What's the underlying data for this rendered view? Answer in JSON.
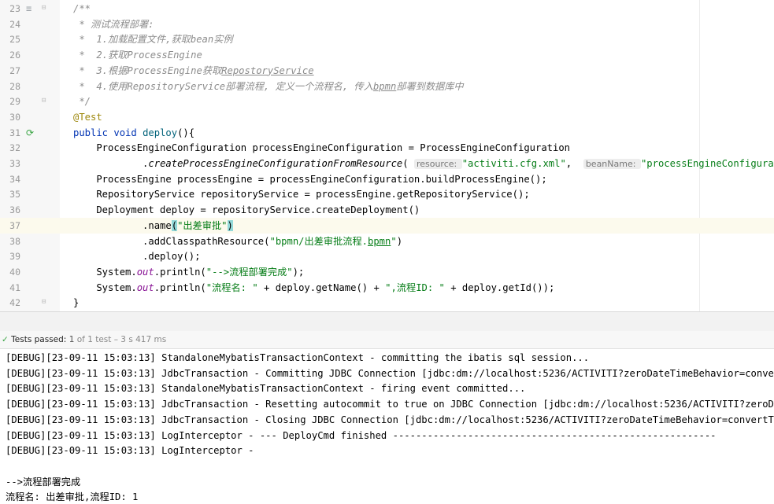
{
  "editor": {
    "lines": [
      {
        "num": "23",
        "segments": [
          {
            "t": "/**",
            "c": "cmt"
          }
        ]
      },
      {
        "num": "24",
        "segments": [
          {
            "t": " * 测试流程部署:",
            "c": "cmt"
          }
        ]
      },
      {
        "num": "25",
        "segments": [
          {
            "t": " *  1.加载配置文件,获取bean实例",
            "c": "cmt"
          }
        ]
      },
      {
        "num": "26",
        "segments": [
          {
            "t": " *  2.获取ProcessEngine",
            "c": "cmt"
          }
        ]
      },
      {
        "num": "27",
        "segments": [
          {
            "t": " *  3.根据ProcessEngine获取",
            "c": "cmt"
          },
          {
            "t": "RepostoryService",
            "c": "cmt ul"
          }
        ]
      },
      {
        "num": "28",
        "segments": [
          {
            "t": " *  4.使用RepositoryService部署流程, 定义一个流程名, 传入",
            "c": "cmt"
          },
          {
            "t": "bpmn",
            "c": "cmt ul"
          },
          {
            "t": "部署到数据库中",
            "c": "cmt"
          }
        ]
      },
      {
        "num": "29",
        "segments": [
          {
            "t": " */",
            "c": "cmt"
          }
        ]
      },
      {
        "num": "30",
        "segments": [
          {
            "t": "@Test",
            "c": "ann"
          }
        ]
      },
      {
        "num": "31",
        "segments": [
          {
            "t": "public void ",
            "c": "kw"
          },
          {
            "t": "deploy",
            "c": "mth"
          },
          {
            "t": "(){",
            "c": ""
          }
        ]
      },
      {
        "num": "32",
        "segments": [
          {
            "t": "    ProcessEngineConfiguration processEngineConfiguration = ProcessEngineConfiguration",
            "c": ""
          }
        ]
      },
      {
        "num": "33",
        "segments": [
          {
            "t": "            .",
            "c": ""
          },
          {
            "t": "createProcessEngineConfigurationFromResource",
            "c": "st"
          },
          {
            "t": "( ",
            "c": ""
          },
          {
            "t": "resource: ",
            "c": "hint"
          },
          {
            "t": "\"activiti.cfg.xml\"",
            "c": "str"
          },
          {
            "t": ",  ",
            "c": ""
          },
          {
            "t": "beanName: ",
            "c": "hint"
          },
          {
            "t": "\"processEngineConfiguration\"",
            "c": "str"
          },
          {
            "t": ");",
            "c": ""
          }
        ]
      },
      {
        "num": "34",
        "segments": [
          {
            "t": "    ProcessEngine processEngine = processEngineConfiguration.buildProcessEngine();",
            "c": ""
          }
        ]
      },
      {
        "num": "35",
        "segments": [
          {
            "t": "    RepositoryService repositoryService = processEngine.getRepositoryService();",
            "c": ""
          }
        ]
      },
      {
        "num": "36",
        "segments": [
          {
            "t": "    Deployment deploy = repositoryService.createDeployment()",
            "c": ""
          }
        ]
      },
      {
        "num": "37",
        "segments": [
          {
            "t": "            .name",
            "c": ""
          },
          {
            "t": "(",
            "c": "paren-hl"
          },
          {
            "t": "\"出差审批\"",
            "c": "str"
          },
          {
            "t": ")",
            "c": "paren-hl"
          }
        ]
      },
      {
        "num": "38",
        "segments": [
          {
            "t": "            .addClasspathResource(",
            "c": ""
          },
          {
            "t": "\"bpmn/出差审批流程.",
            "c": "str"
          },
          {
            "t": "bpmn",
            "c": "str ul"
          },
          {
            "t": "\"",
            "c": "str"
          },
          {
            "t": ")",
            "c": ""
          }
        ]
      },
      {
        "num": "39",
        "segments": [
          {
            "t": "            .deploy();",
            "c": ""
          }
        ]
      },
      {
        "num": "40",
        "segments": [
          {
            "t": "    System.",
            "c": ""
          },
          {
            "t": "out",
            "c": "fld"
          },
          {
            "t": ".println(",
            "c": ""
          },
          {
            "t": "\"-->流程部署完成\"",
            "c": "str"
          },
          {
            "t": ");",
            "c": ""
          }
        ]
      },
      {
        "num": "41",
        "segments": [
          {
            "t": "    System.",
            "c": ""
          },
          {
            "t": "out",
            "c": "fld"
          },
          {
            "t": ".println(",
            "c": ""
          },
          {
            "t": "\"流程名: \"",
            "c": "str"
          },
          {
            "t": " + deploy.getName() + ",
            "c": ""
          },
          {
            "t": "\",流程ID: \"",
            "c": "str"
          },
          {
            "t": " + deploy.getId());",
            "c": ""
          }
        ]
      },
      {
        "num": "42",
        "segments": [
          {
            "t": "}",
            "c": ""
          }
        ]
      }
    ]
  },
  "tests_bar": {
    "label": "Tests passed:",
    "count": "1",
    "details": "of 1 test – 3 s 417 ms"
  },
  "console": {
    "lines": [
      "[DEBUG][23-09-11 15:03:13] StandaloneMybatisTransactionContext - committing the ibatis sql session...",
      "[DEBUG][23-09-11 15:03:13] JdbcTransaction - Committing JDBC Connection [jdbc:dm://localhost:5236/ACTIVITI?zeroDateTimeBehavior=convertToNull&useUnicode",
      "[DEBUG][23-09-11 15:03:13] StandaloneMybatisTransactionContext - firing event committed...",
      "[DEBUG][23-09-11 15:03:13] JdbcTransaction - Resetting autocommit to true on JDBC Connection [jdbc:dm://localhost:5236/ACTIVITI?zeroDateTimeBehavior",
      "[DEBUG][23-09-11 15:03:13] JdbcTransaction - Closing JDBC Connection [jdbc:dm://localhost:5236/ACTIVITI?zeroDateTimeBehavior=convertToNull&useUnicode",
      "[DEBUG][23-09-11 15:03:13] LogInterceptor - --- DeployCmd finished --------------------------------------------------------",
      "[DEBUG][23-09-11 15:03:13] LogInterceptor - ",
      "",
      "-->流程部署完成",
      "流程名: 出差审批,流程ID: 1"
    ]
  }
}
